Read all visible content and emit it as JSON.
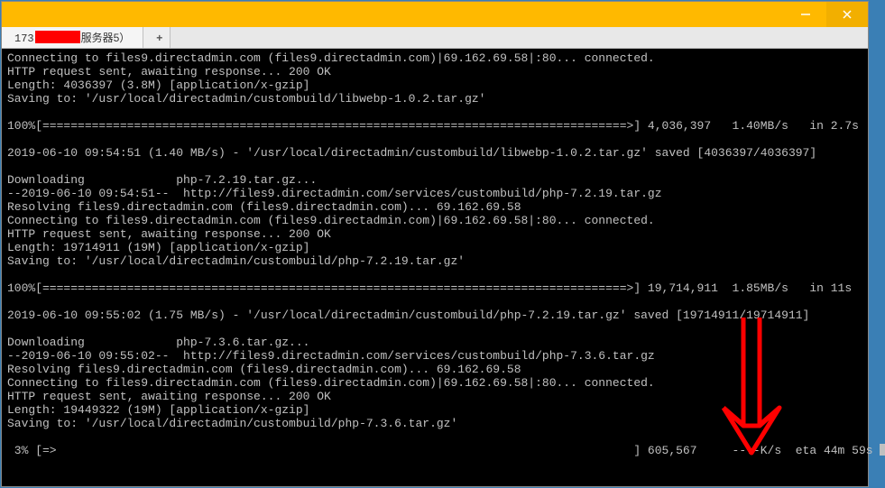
{
  "window": {
    "tab_prefix": "173",
    "tab_suffix": "服务器5）",
    "plus": "+"
  },
  "term": {
    "l01": "Connecting to files9.directadmin.com (files9.directadmin.com)|69.162.69.58|:80... connected.",
    "l02": "HTTP request sent, awaiting response... 200 OK",
    "l03": "Length: 4036397 (3.8M) [application/x-gzip]",
    "l04": "Saving to: '/usr/local/directadmin/custombuild/libwebp-1.0.2.tar.gz'",
    "l05": "",
    "l06": "100%[===================================================================================>] 4,036,397   1.40MB/s   in 2.7s",
    "l07": "",
    "l08": "2019-06-10 09:54:51 (1.40 MB/s) - '/usr/local/directadmin/custombuild/libwebp-1.0.2.tar.gz' saved [4036397/4036397]",
    "l09": "",
    "l10": "Downloading\t\tphp-7.2.19.tar.gz...",
    "l11": "--2019-06-10 09:54:51--  http://files9.directadmin.com/services/custombuild/php-7.2.19.tar.gz",
    "l12": "Resolving files9.directadmin.com (files9.directadmin.com)... 69.162.69.58",
    "l13": "Connecting to files9.directadmin.com (files9.directadmin.com)|69.162.69.58|:80... connected.",
    "l14": "HTTP request sent, awaiting response... 200 OK",
    "l15": "Length: 19714911 (19M) [application/x-gzip]",
    "l16": "Saving to: '/usr/local/directadmin/custombuild/php-7.2.19.tar.gz'",
    "l17": "",
    "l18": "100%[===================================================================================>] 19,714,911  1.85MB/s   in 11s",
    "l19": "",
    "l20": "2019-06-10 09:55:02 (1.75 MB/s) - '/usr/local/directadmin/custombuild/php-7.2.19.tar.gz' saved [19714911/19714911]",
    "l21": "",
    "l22": "Downloading\t\tphp-7.3.6.tar.gz...",
    "l23": "--2019-06-10 09:55:02--  http://files9.directadmin.com/services/custombuild/php-7.3.6.tar.gz",
    "l24": "Resolving files9.directadmin.com (files9.directadmin.com)... 69.162.69.58",
    "l25": "Connecting to files9.directadmin.com (files9.directadmin.com)|69.162.69.58|:80... connected.",
    "l26": "HTTP request sent, awaiting response... 200 OK",
    "l27": "Length: 19449322 (19M) [application/x-gzip]",
    "l28": "Saving to: '/usr/local/directadmin/custombuild/php-7.3.6.tar.gz'",
    "l29": "",
    "l30": " 3% [=>                                                                                  ] 605,567     --.-K/s  eta 44m 59s "
  }
}
